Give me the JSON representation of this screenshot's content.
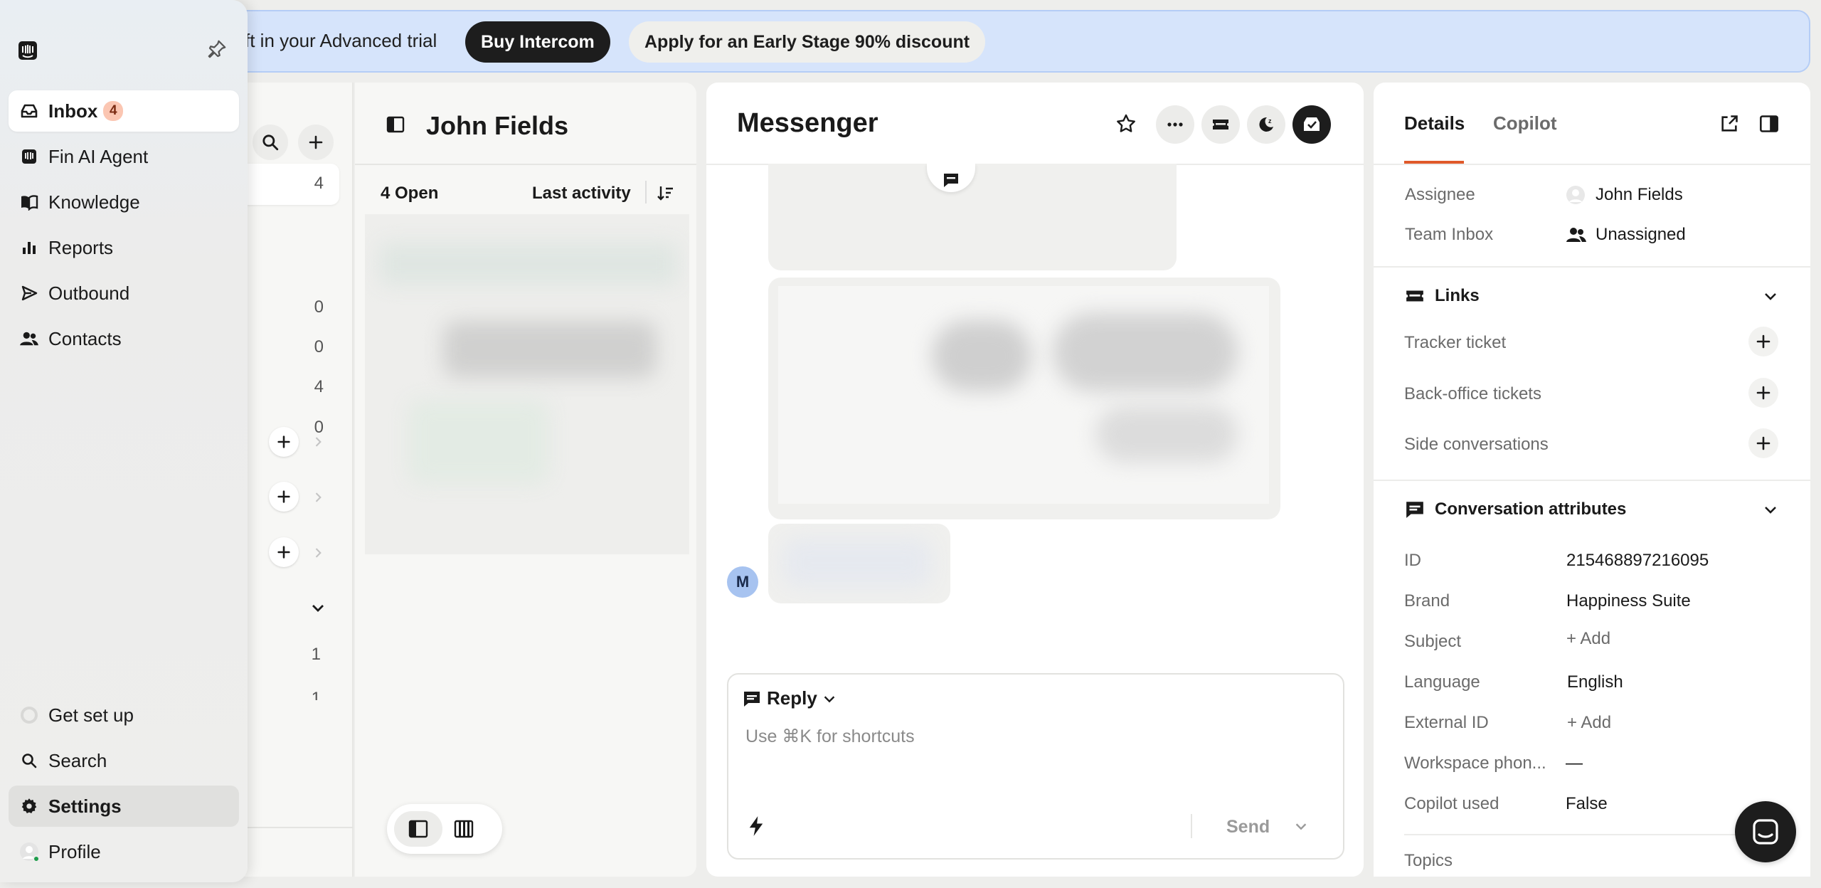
{
  "banner": {
    "text": "ft in your Advanced trial",
    "buy_label": "Buy Intercom",
    "discount_label": "Apply for an Early Stage 90% discount"
  },
  "sidebar": {
    "items": [
      {
        "label": "Inbox",
        "badge": "4",
        "icon": "inbox-icon"
      },
      {
        "label": "Fin AI Agent",
        "icon": "fin-icon"
      },
      {
        "label": "Knowledge",
        "icon": "book-icon"
      },
      {
        "label": "Reports",
        "icon": "bar-chart-icon"
      },
      {
        "label": "Outbound",
        "icon": "send-icon"
      },
      {
        "label": "Contacts",
        "icon": "people-icon"
      }
    ],
    "bottom": [
      {
        "label": "Get set up",
        "icon": "progress-icon"
      },
      {
        "label": "Search",
        "icon": "search-icon"
      },
      {
        "label": "Settings",
        "icon": "gear-icon"
      },
      {
        "label": "Profile",
        "icon": "avatar-icon"
      }
    ]
  },
  "inbox_counts": [
    "4",
    "0",
    "0",
    "4",
    "0"
  ],
  "inbox_bottom_counts": [
    "1",
    "1"
  ],
  "conversation_list": {
    "title": "John Fields",
    "open_count": "4 Open",
    "sort_label": "Last activity"
  },
  "messenger": {
    "title": "Messenger",
    "avatar_initial": "M",
    "composer": {
      "mode_label": "Reply",
      "placeholder": "Use ⌘K for shortcuts",
      "send_label": "Send"
    }
  },
  "details": {
    "tabs": [
      "Details",
      "Copilot"
    ],
    "assignee_label": "Assignee",
    "assignee_value": "John Fields",
    "team_label": "Team Inbox",
    "team_value": "Unassigned",
    "links_title": "Links",
    "links": [
      "Tracker ticket",
      "Back-office tickets",
      "Side conversations"
    ],
    "attributes_title": "Conversation attributes",
    "attributes": [
      {
        "label": "ID",
        "value": "215468897216095"
      },
      {
        "label": "Brand",
        "value": "Happiness Suite"
      },
      {
        "label": "Subject",
        "value": "+ Add"
      },
      {
        "label": "Language",
        "value": "English"
      },
      {
        "label": "External ID",
        "value": "+ Add"
      },
      {
        "label": "Workspace phon...",
        "value": "—"
      },
      {
        "label": "Copilot used",
        "value": "False"
      }
    ],
    "topics_label": "Topics"
  },
  "colors": {
    "accent": "#e0592a",
    "banner_bg": "#d6e4fb",
    "badge_bg": "#fbc6b2",
    "avatar_bg": "#a7c3f0"
  }
}
